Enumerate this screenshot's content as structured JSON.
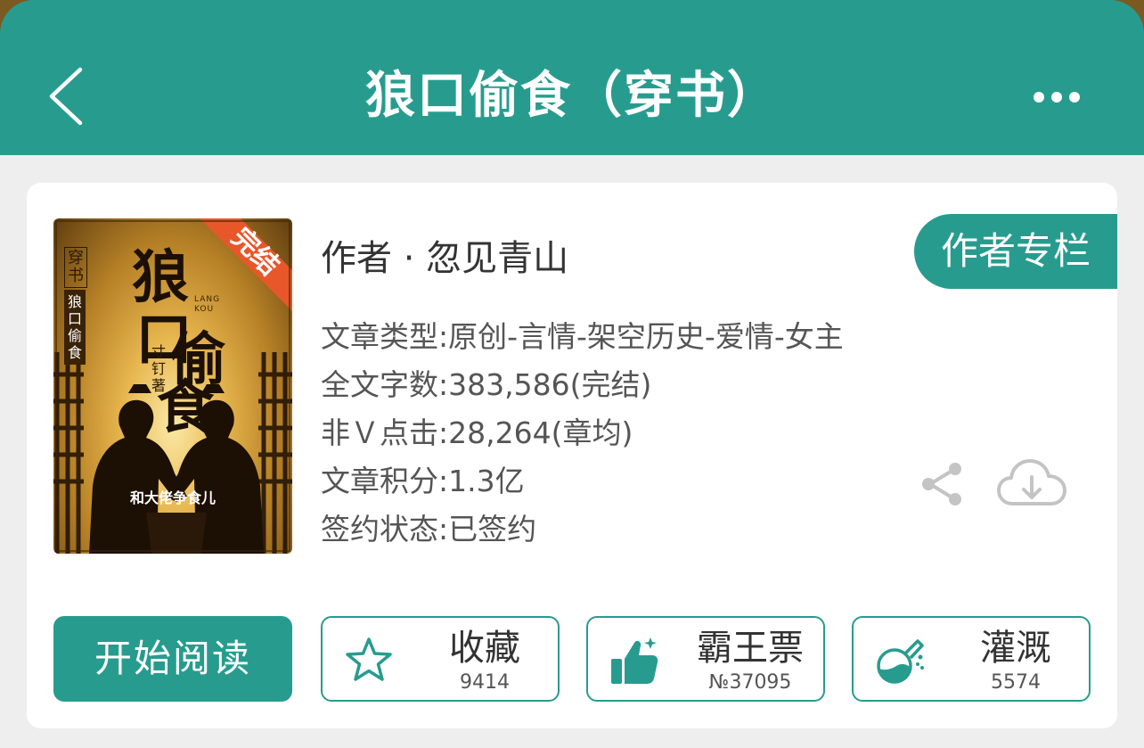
{
  "header": {
    "title": "狼口偷食（穿书）"
  },
  "book": {
    "cover": {
      "badge": "完结",
      "genre_tag": "穿书",
      "title_chars": [
        "狼",
        "口",
        "偷",
        "食"
      ],
      "pinyin": "LANG KOU",
      "side_title": "狼口偷食",
      "author_mark": "寸钉 著",
      "tagline": "和大佬争食儿"
    },
    "author_line": "作者 · 忽见青山",
    "author_column_label": "作者专栏",
    "info": [
      "文章类型:原创-言情-架空历史-爱情-女主",
      "全文字数:383,586(完结)",
      "非Ｖ点击:28,264(章均)",
      "文章积分:1.3亿",
      "签约状态:已签约"
    ]
  },
  "actions": {
    "read_label": "开始阅读",
    "favorite": {
      "label": "收藏",
      "count": "9414"
    },
    "ticket": {
      "label": "霸王票",
      "count": "№37095"
    },
    "water": {
      "label": "灌溉",
      "count": "5574"
    }
  },
  "colors": {
    "accent": "#279c8e",
    "badge": "#e8572a",
    "background": "#eeeeee"
  },
  "icons": {
    "back": "chevron-left-icon",
    "more": "more-dots-icon",
    "share": "share-icon",
    "download": "cloud-download-icon",
    "favorite": "star-icon",
    "ticket": "thumbs-up-icon",
    "water": "flask-icon"
  }
}
